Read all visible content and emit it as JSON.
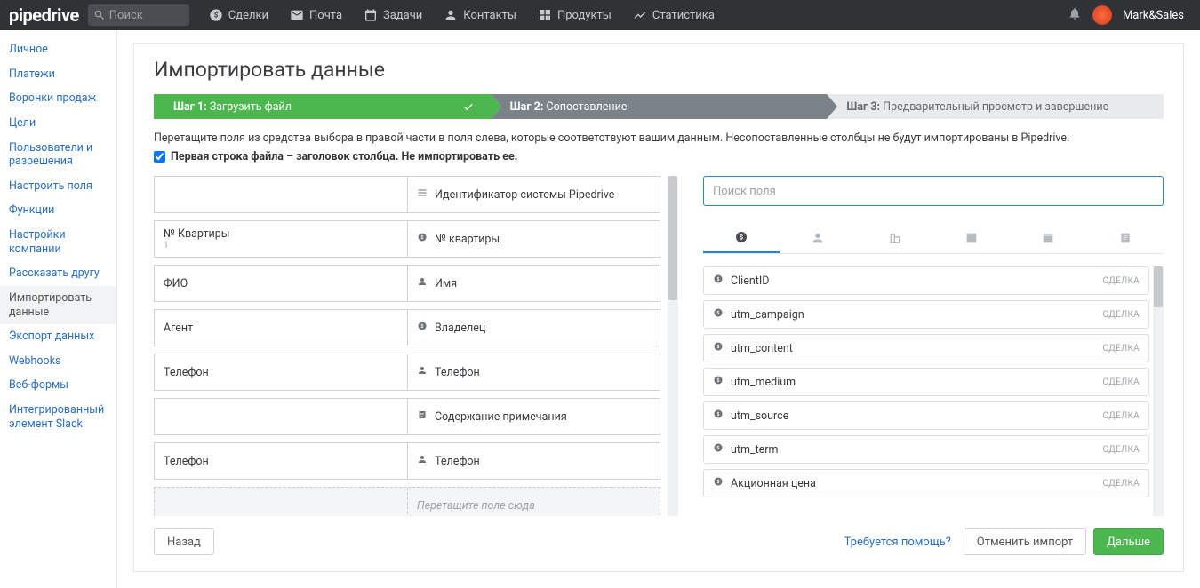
{
  "topbar": {
    "logo": "pipedrive",
    "search_placeholder": "Поиск",
    "nav": {
      "deals": "Сделки",
      "mail": "Почта",
      "tasks": "Задачи",
      "contacts": "Контакты",
      "products": "Продукты",
      "stats": "Статистика"
    },
    "username": "Mark&Sales"
  },
  "sidebar": {
    "items": [
      {
        "key": "personal",
        "label": "Личное"
      },
      {
        "key": "payments",
        "label": "Платежи"
      },
      {
        "key": "pipelines",
        "label": "Воронки продаж"
      },
      {
        "key": "goals",
        "label": "Цели"
      },
      {
        "key": "users",
        "label": "Пользователи и разрешения"
      },
      {
        "key": "fields",
        "label": "Настроить поля"
      },
      {
        "key": "features",
        "label": "Функции"
      },
      {
        "key": "company",
        "label": "Настройки компании"
      },
      {
        "key": "refer",
        "label": "Рассказать другу"
      },
      {
        "key": "import",
        "label": "Импортировать данные"
      },
      {
        "key": "export",
        "label": "Экспорт данных"
      },
      {
        "key": "webhooks",
        "label": "Webhooks"
      },
      {
        "key": "webforms",
        "label": "Веб-формы"
      },
      {
        "key": "slack",
        "label": "Интегрированный элемент Slack"
      }
    ]
  },
  "page": {
    "title": "Импортировать данные",
    "steps": {
      "s1_prefix": "Шаг 1: ",
      "s1": "Загрузить файл",
      "s2_prefix": "Шаг 2: ",
      "s2": "Сопоставление",
      "s3_prefix": "Шаг 3: ",
      "s3": "Предварительный просмотр и завершение"
    },
    "hint": "Перетащите поля из средства выбора в правой части в поля слева, которые соответствуют вашим данным. Несопоставленные столбцы не будут импортированы в Pipedrive.",
    "first_row_label": "Первая строка файла – заголовок столбца. Не импортировать ее.",
    "first_row_checked": true
  },
  "mapping": {
    "rows": [
      {
        "left": "",
        "sub": "",
        "right": "Идентификатор системы Pipedrive",
        "icon": "bars"
      },
      {
        "left": "№ Квартиры",
        "sub": "1",
        "right": "№ квартиры",
        "icon": "deal"
      },
      {
        "left": "ФИО",
        "sub": "",
        "right": "Имя",
        "icon": "person"
      },
      {
        "left": "Агент",
        "sub": "",
        "right": "Владелец",
        "icon": "deal"
      },
      {
        "left": "Телефон",
        "sub": "",
        "right": "Телефон",
        "icon": "person"
      },
      {
        "left": "",
        "sub": "",
        "right": "Содержание примечания",
        "icon": "note"
      },
      {
        "left": "Телефон",
        "sub": "",
        "right": "Телефон",
        "icon": "person"
      }
    ],
    "drop_placeholder": "Перетащите поле сюда"
  },
  "picker": {
    "search_placeholder": "Поиск поля",
    "fields": [
      {
        "label": "ClientID",
        "badge": "СДЕЛКА"
      },
      {
        "label": "utm_campaign",
        "badge": "СДЕЛКА"
      },
      {
        "label": "utm_content",
        "badge": "СДЕЛКА"
      },
      {
        "label": "utm_medium",
        "badge": "СДЕЛКА"
      },
      {
        "label": "utm_source",
        "badge": "СДЕЛКА"
      },
      {
        "label": "utm_term",
        "badge": "СДЕЛКА"
      },
      {
        "label": "Акционная цена",
        "badge": "СДЕЛКА"
      }
    ]
  },
  "footer": {
    "back": "Назад",
    "help": "Требуется помощь?",
    "cancel": "Отменить импорт",
    "next": "Дальше"
  }
}
